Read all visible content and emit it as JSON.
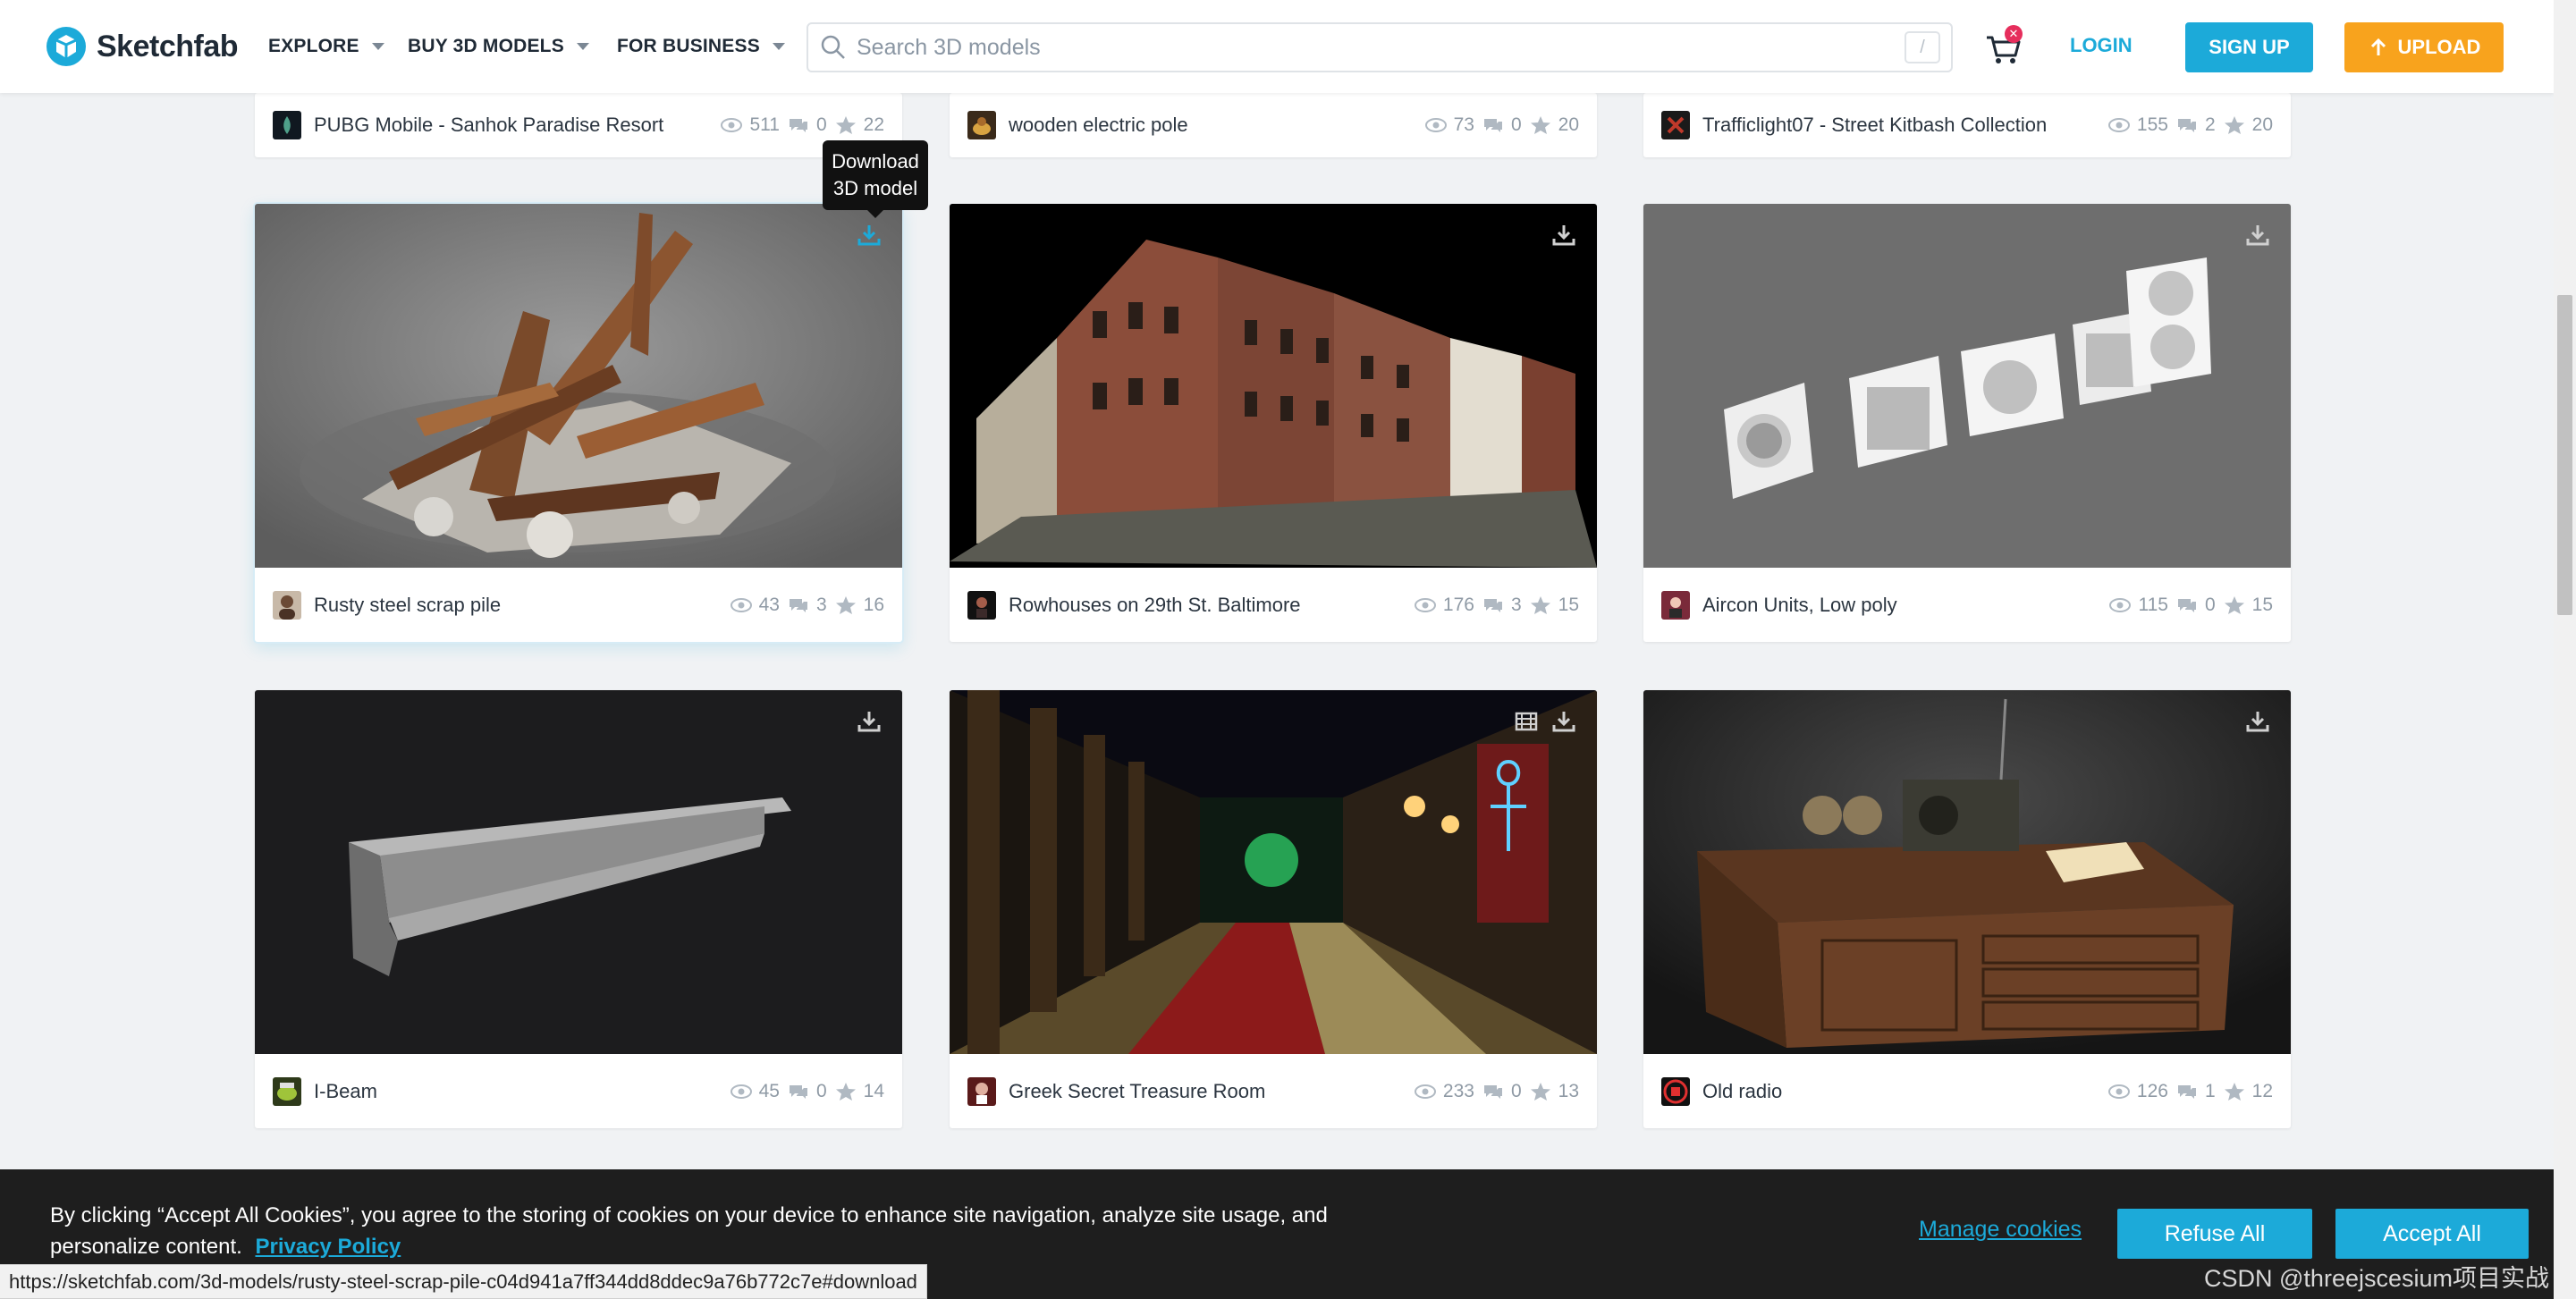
{
  "header": {
    "logo_text": "Sketchfab",
    "nav": [
      {
        "label": "EXPLORE"
      },
      {
        "label": "BUY 3D MODELS"
      },
      {
        "label": "FOR BUSINESS"
      }
    ],
    "search_placeholder": "Search 3D models",
    "search_shortcut": "/",
    "cart_badge": "✕",
    "login_label": "LOGIN",
    "signup_label": "SIGN UP",
    "upload_label": "UPLOAD"
  },
  "tooltip": {
    "line1": "Download",
    "line2": "3D model"
  },
  "cards_top": [
    {
      "title": "PUBG Mobile - Sanhok Paradise Resort",
      "views": "511",
      "comments": "0",
      "likes": "22"
    },
    {
      "title": "wooden electric pole",
      "views": "73",
      "comments": "0",
      "likes": "20"
    },
    {
      "title": "Trafficlight07 - Street Kitbash Collection",
      "views": "155",
      "comments": "2",
      "likes": "20"
    }
  ],
  "cards": [
    {
      "title": "Rusty steel scrap pile",
      "views": "43",
      "comments": "3",
      "likes": "16"
    },
    {
      "title": "Rowhouses on 29th St. Baltimore",
      "views": "176",
      "comments": "3",
      "likes": "15"
    },
    {
      "title": "Aircon Units, Low poly",
      "views": "115",
      "comments": "0",
      "likes": "15"
    },
    {
      "title": "I-Beam",
      "views": "45",
      "comments": "0",
      "likes": "14"
    },
    {
      "title": "Greek Secret Treasure Room",
      "views": "233",
      "comments": "0",
      "likes": "13"
    },
    {
      "title": "Old radio",
      "views": "126",
      "comments": "1",
      "likes": "12"
    }
  ],
  "cookie": {
    "text": "By clicking “Accept All Cookies”, you agree to the storing of cookies on your device to enhance site navigation, analyze site usage, and personalize content.",
    "privacy_label": "Privacy Policy",
    "manage_label": "Manage cookies",
    "refuse_label": "Refuse All",
    "accept_label": "Accept All"
  },
  "status_url": "https://sketchfab.com/3d-models/rusty-steel-scrap-pile-c04d941a7ff344dd8ddec9a76b772c7e#download",
  "watermark": "CSDN @threejscesium项目实战",
  "colors": {
    "accent": "#1caad9",
    "upload": "#f8a31d",
    "badge": "#e62e5c"
  }
}
